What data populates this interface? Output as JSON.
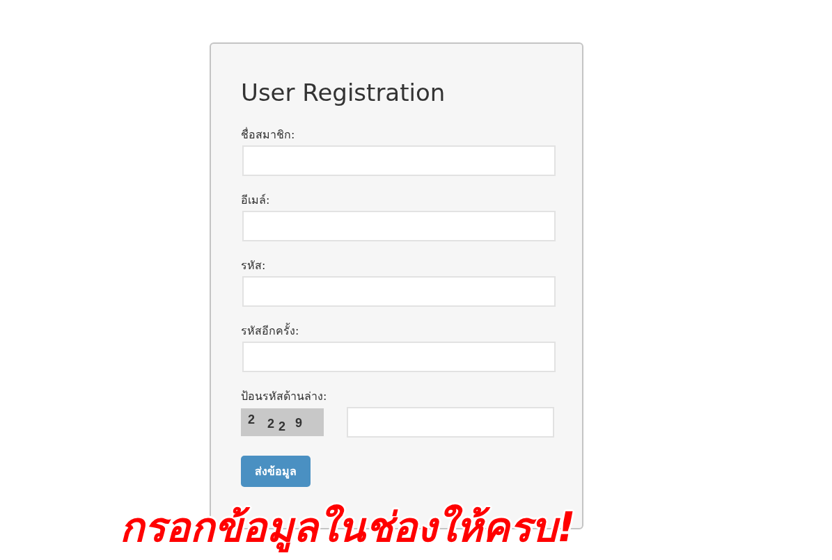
{
  "form": {
    "title": "User Registration",
    "fields": [
      {
        "label": "ชื่อสมาชิก:",
        "kind": "text"
      },
      {
        "label": "อีเมล์:",
        "kind": "text"
      },
      {
        "label": "รหัส:",
        "kind": "text"
      },
      {
        "label": "รหัสอีกครั้ง:",
        "kind": "text"
      },
      {
        "label": "ป้อนรหัสด้านล่าง:",
        "kind": "captcha",
        "captcha": [
          "2",
          "2",
          "2",
          "9"
        ]
      }
    ],
    "submit": "ส่งข้อมูล"
  },
  "notice": "กรอกข้อมูลในช่องให้ครบ!"
}
